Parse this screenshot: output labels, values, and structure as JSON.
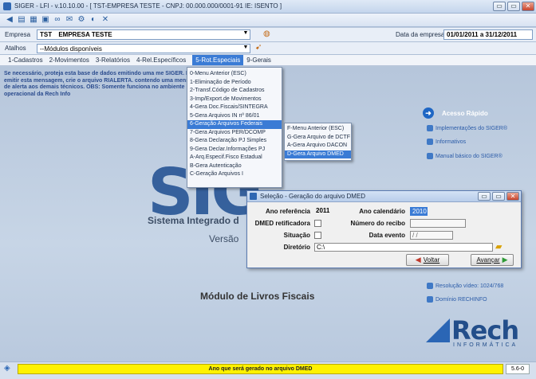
{
  "window": {
    "title": "SIGER - LFI - v.10.10.00 - [ TST-EMPRESA TESTE - CNPJ: 00.000.000/0001-91 IE: ISENTO ]",
    "minimize": "▭",
    "maximize": "▭",
    "close": "✕"
  },
  "toolbar": {
    "icons": [
      "exit-icon",
      "list-icon",
      "calendar-icon",
      "document-icon",
      "glasses-icon",
      "mail-icon",
      "settings-icon",
      "search-icon",
      "tools-icon"
    ]
  },
  "empresa": {
    "label": "Empresa",
    "code": "TST",
    "name": "EMPRESA TESTE",
    "data_label": "Data da empresa",
    "data_value": "01/01/2011 a 31/12/2011"
  },
  "atalhos": {
    "label": "Atalhos",
    "value": "--Módulos disponíveis"
  },
  "menubar": [
    {
      "label": "1-Cadastros"
    },
    {
      "label": "2-Movimentos"
    },
    {
      "label": "3-Relatórios"
    },
    {
      "label": "4-Rel.Específicos"
    },
    {
      "label": "5-Rot.Especiais"
    },
    {
      "label": "9-Gerais"
    }
  ],
  "warning": "Se necessário, proteja esta base de dados emitindo uma me SIGER. Para emitir esta mensagem, crie o arquivo RIALERTA. contendo uma mensagem de alerta aos demais técnicos. OBS: Somente funciona no ambiente operacional da Rech Info",
  "menu1": [
    "0-Menu Anterior (ESC)",
    "1-Eliminação de Período",
    "2-Transf.Código de Cadastros",
    "3-Imp/Export.de Movimentos",
    "4-Gera Doc.Fiscais/SINTEGRA",
    "5-Gera Arquivos IN nº 86/01",
    "6-Geração Arquivos Federais",
    "7-Gera Arquivos PER/DCOMP",
    "8-Gera Declaração PJ Simples",
    "9-Gera Declar.Informações PJ",
    "A-Arq.Especif.Fisco Estadual",
    "B-Gera Autenticação",
    "C-Geração Arquivos I"
  ],
  "menu2": [
    "F-Menu Anterior (ESC)",
    "G-Gera Arquivo de DCTF",
    "A-Gera Arquivo DACON",
    "D-Gera Arquivo DMED"
  ],
  "logo": {
    "big": "SIG",
    "system_name": "Sistema Integrado d",
    "versao": "Versão",
    "module": "Módulo de Livros Fiscais"
  },
  "quick": {
    "title": "Acesso Rápido",
    "links": [
      "Implementações do SIGER®",
      "Informativos",
      "Manual básico do SIGER®"
    ],
    "bottom_links": [
      "Resolução vídeo: 1024/768",
      "Domínio RECHINFO"
    ]
  },
  "rech": {
    "name": "Rech",
    "sub": "INFORMÁTICA"
  },
  "dialog": {
    "title": "Seleção - Geração do arquivo DMED",
    "ano_ref_label": "Ano referência",
    "ano_ref_value": "2011",
    "ano_cal_label": "Ano calendário",
    "ano_cal_value": "2010",
    "retif_label": "DMED retificadora",
    "recibo_label": "Número do recibo",
    "recibo_value": "",
    "situacao_label": "Situação",
    "evento_label": "Data evento",
    "evento_value": " / /",
    "dir_label": "Diretório",
    "dir_value": "C:\\",
    "voltar": "Voltar",
    "avancar": "Avançar"
  },
  "status": {
    "message": "Ano que será gerado no arquivo DMED",
    "code": "5.6-0"
  }
}
